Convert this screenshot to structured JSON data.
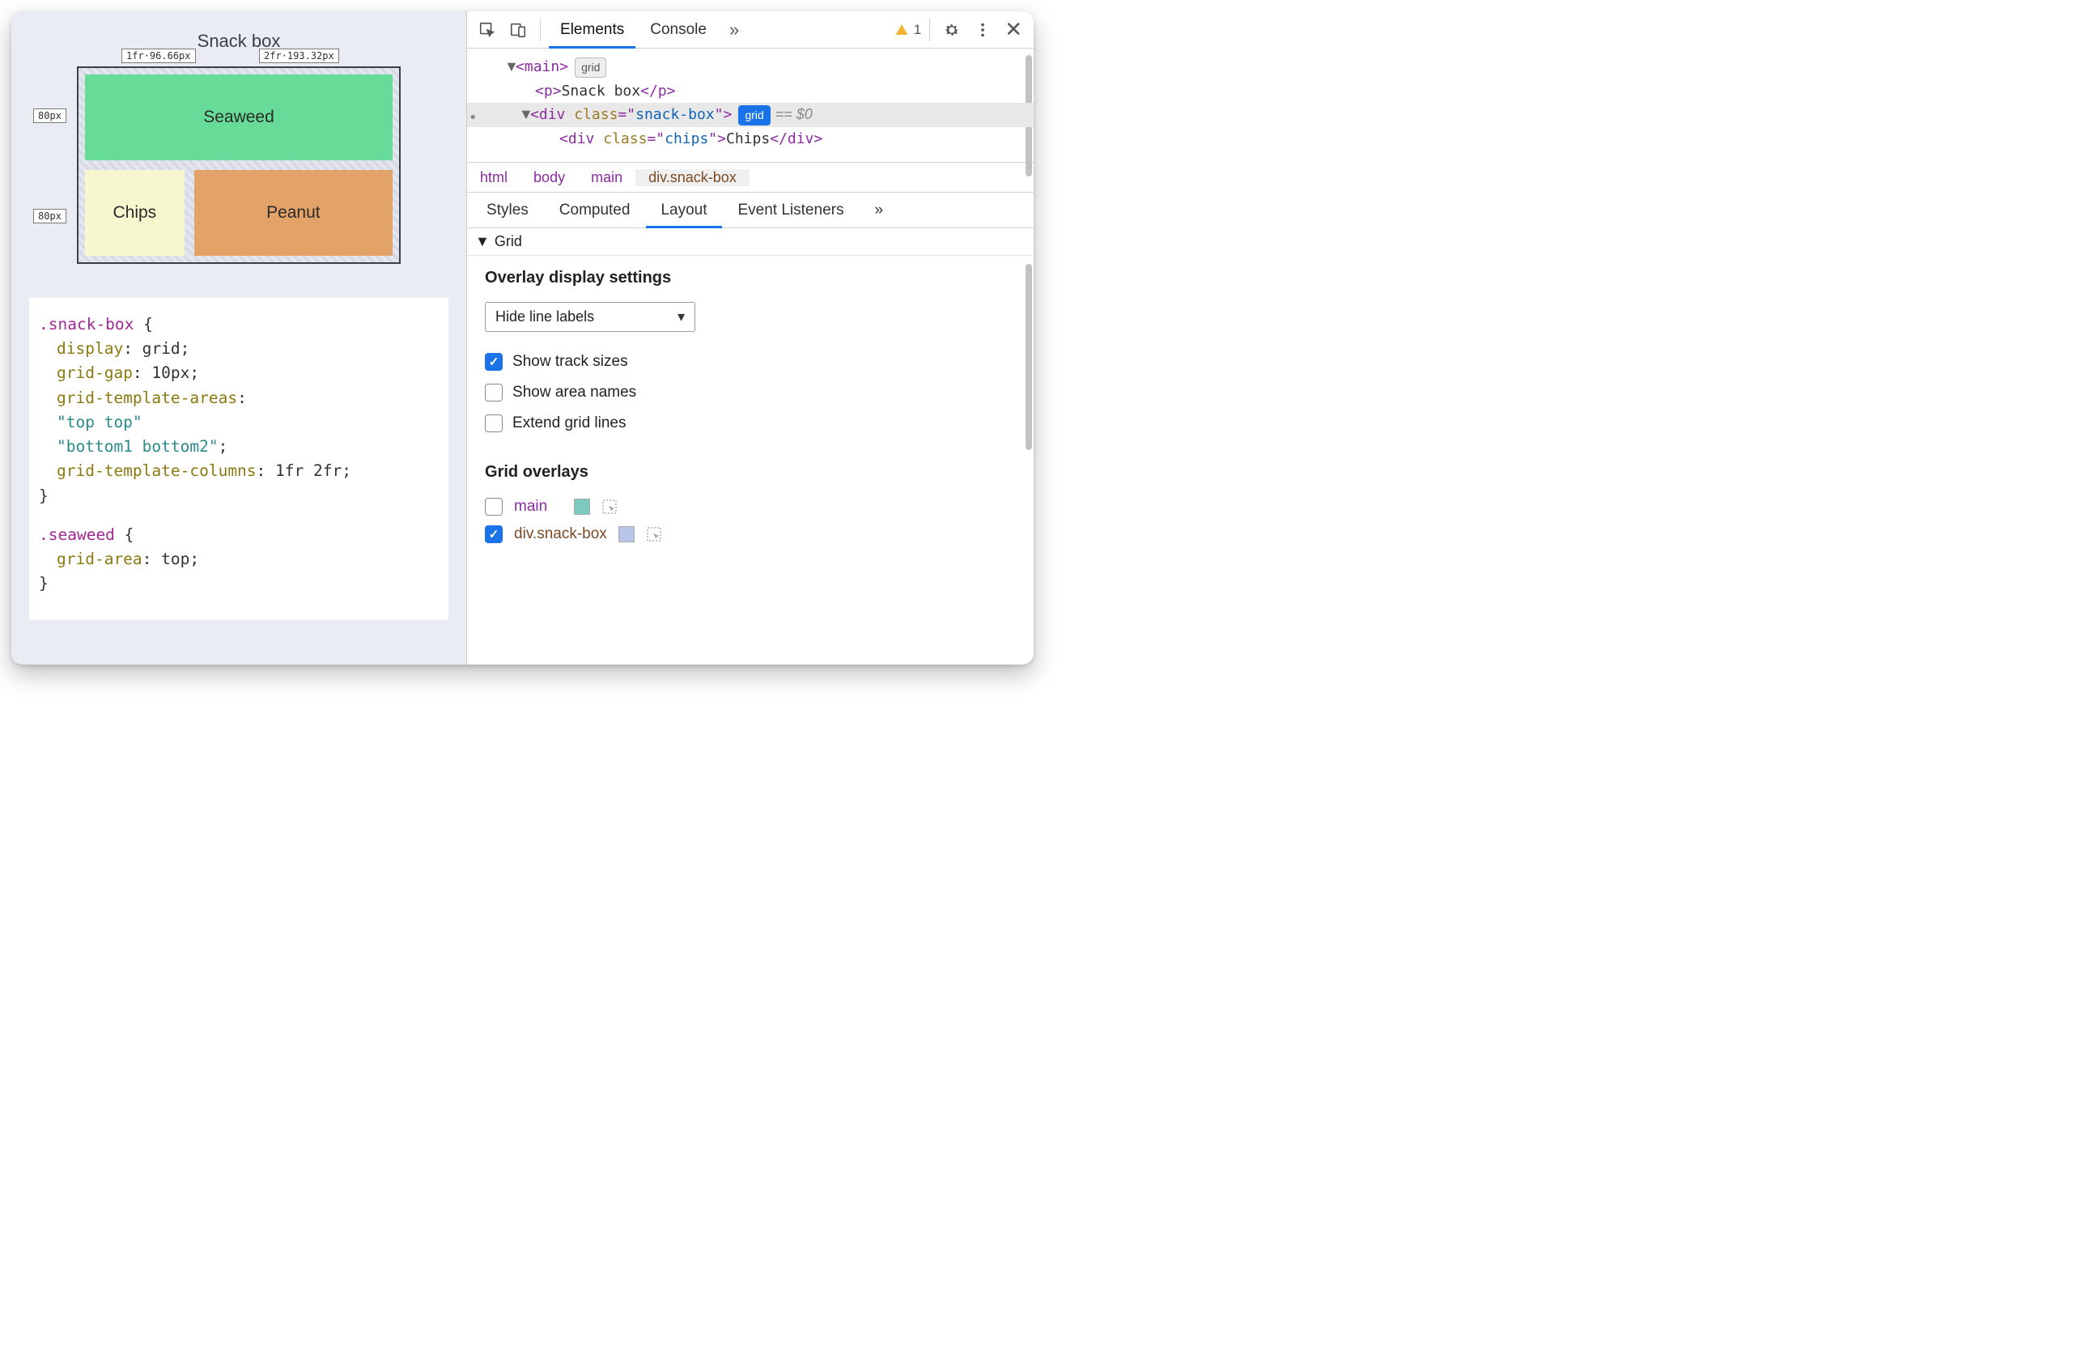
{
  "viewport": {
    "title": "Snack box",
    "grid_overlay": {
      "col1": "1fr·96.66px",
      "col2": "2fr·193.32px",
      "row1": "80px",
      "row2": "80px"
    },
    "cells": {
      "seaweed": "Seaweed",
      "chips": "Chips",
      "peanut": "Peanut"
    },
    "css_code": {
      "rule1_selector": ".snack-box",
      "rule1_decls": [
        {
          "prop": "display",
          "val": "grid"
        },
        {
          "prop": "grid-gap",
          "val": "10px"
        },
        {
          "prop": "grid-template-areas",
          "val_lines": [
            "\"top top\"",
            "\"bottom1 bottom2\""
          ]
        },
        {
          "prop": "grid-template-columns",
          "val": "1fr 2fr"
        }
      ],
      "rule2_selector": ".seaweed",
      "rule2_decls": [
        {
          "prop": "grid-area",
          "val": "top"
        }
      ]
    }
  },
  "toolbar": {
    "tab_elements": "Elements",
    "tab_console": "Console",
    "more_glyph": "»",
    "warning_count": "1"
  },
  "dom": {
    "l1_tag": "main",
    "l1_badge": "grid",
    "l2_tag": "p",
    "l2_text": "Snack box",
    "l3_tag": "div",
    "l3_attr": "class",
    "l3_val": "snack-box",
    "l3_badge": "grid",
    "l3_ref": "== $0",
    "l4_tag": "div",
    "l4_attr": "class",
    "l4_val": "chips",
    "l4_text": "Chips"
  },
  "breadcrumb": {
    "c1": "html",
    "c2": "body",
    "c3": "main",
    "c4": "div.snack-box"
  },
  "subtabs": {
    "styles": "Styles",
    "computed": "Computed",
    "layout": "Layout",
    "event": "Event Listeners",
    "more": "»"
  },
  "layout_panel": {
    "section": "Grid",
    "ods_title": "Overlay display settings",
    "select_value": "Hide line labels",
    "cb1": "Show track sizes",
    "cb2": "Show area names",
    "cb3": "Extend grid lines",
    "go_title": "Grid overlays",
    "go1_name": "main",
    "go2_name": "div.snack-box"
  }
}
